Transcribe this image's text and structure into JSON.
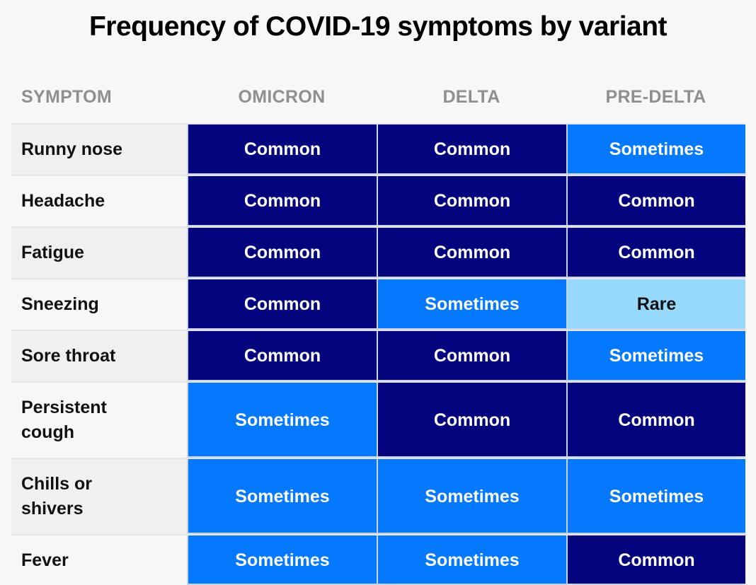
{
  "title": "Frequency of COVID-19 symptoms by variant",
  "colors": {
    "Common": "#03037d",
    "Sometimes": "#0479fd",
    "Rare": "#97d8fd"
  },
  "text_colors": {
    "Common": "#ffffff",
    "Sometimes": "#ffffff",
    "Rare": "#111111"
  },
  "chart_data": {
    "type": "table",
    "title": "Frequency of COVID-19 symptoms by variant",
    "columns": [
      "SYMPTOM",
      "OMICRON",
      "DELTA",
      "PRE-DELTA"
    ],
    "rows": [
      {
        "symptom": "Runny nose",
        "values": [
          "Common",
          "Common",
          "Sometimes"
        ]
      },
      {
        "symptom": "Headache",
        "values": [
          "Common",
          "Common",
          "Common"
        ]
      },
      {
        "symptom": "Fatigue",
        "values": [
          "Common",
          "Common",
          "Common"
        ]
      },
      {
        "symptom": "Sneezing",
        "values": [
          "Common",
          "Sometimes",
          "Rare"
        ]
      },
      {
        "symptom": "Sore throat",
        "values": [
          "Common",
          "Common",
          "Sometimes"
        ]
      },
      {
        "symptom": "Persistent cough",
        "values": [
          "Sometimes",
          "Common",
          "Common"
        ]
      },
      {
        "symptom": "Chills or shivers",
        "values": [
          "Sometimes",
          "Sometimes",
          "Sometimes"
        ]
      },
      {
        "symptom": "Fever",
        "values": [
          "Sometimes",
          "Sometimes",
          "Common"
        ]
      }
    ]
  }
}
